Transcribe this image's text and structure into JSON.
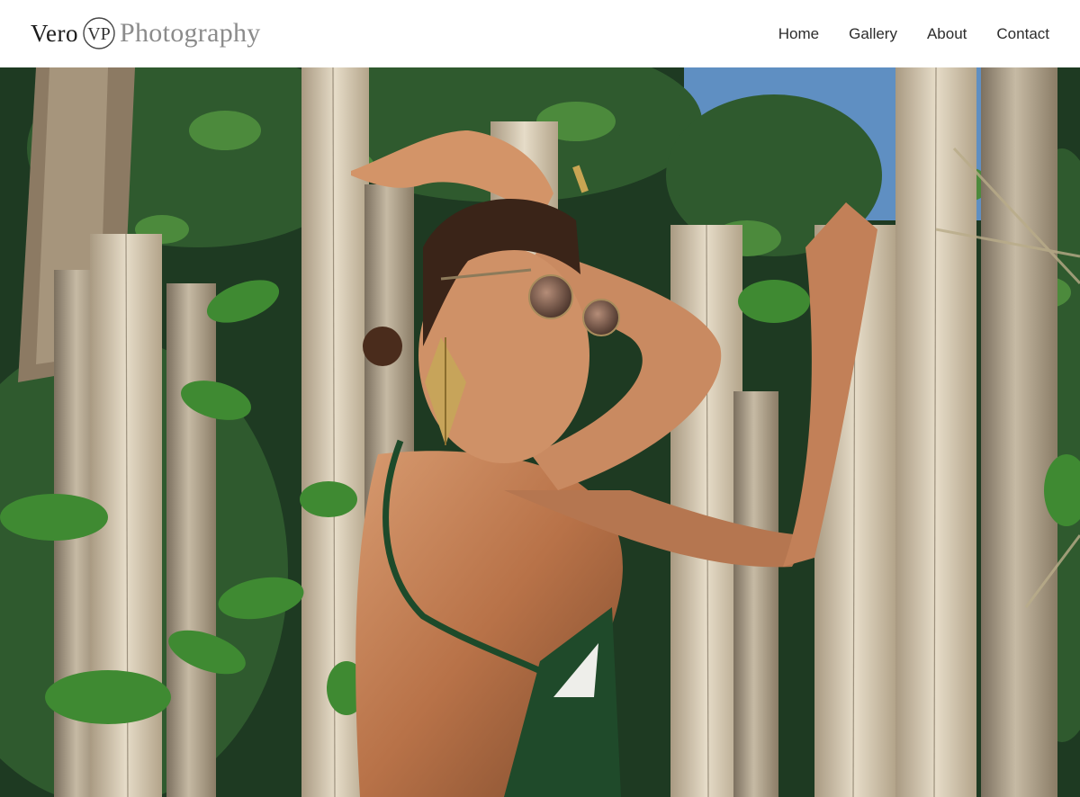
{
  "logo": {
    "vero": "Vero",
    "monogram": "VP",
    "photography": "Photography"
  },
  "nav": {
    "items": [
      "Home",
      "Gallery",
      "About",
      "Contact"
    ]
  },
  "hero": {
    "image": "portrait-hero-photo"
  }
}
